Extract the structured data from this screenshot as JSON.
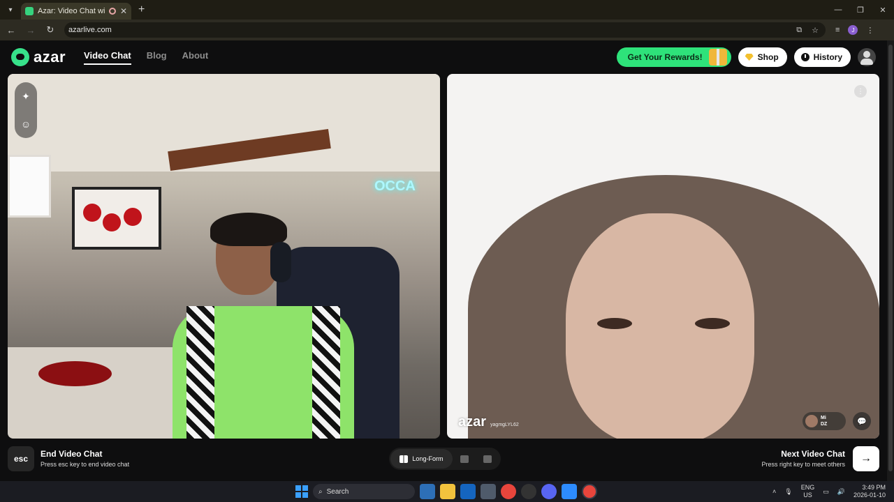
{
  "browser": {
    "tab_title": "Azar: Video Chat with New",
    "tab_close": "✕",
    "new_tab": "+",
    "url": "azarlive.com",
    "profile_initial": "J",
    "window_controls": [
      "—",
      "❐",
      "✕"
    ]
  },
  "header": {
    "logo_text": "azar",
    "nav": [
      "Video Chat",
      "Blog",
      "About"
    ],
    "active_nav": "Video Chat",
    "rewards_label": "Get Your Rewards!",
    "shop_label": "Shop",
    "history_label": "History"
  },
  "left_video": {
    "neon_sign": "OCCA"
  },
  "right_video": {
    "watermark_logo": "azar",
    "watermark_id": "yagmgLYL62",
    "partner_name": "Mi",
    "partner_country": "DZ"
  },
  "controls": {
    "esc_key": "esc",
    "end_title": "End Video Chat",
    "end_hint": "Press esc key to end video chat",
    "layout_label": "Long-Form",
    "next_title": "Next Video Chat",
    "next_hint": "Press right key to meet others",
    "next_arrow": "→"
  },
  "taskbar": {
    "search_placeholder": "Search",
    "lang_top": "ENG",
    "lang_bottom": "US",
    "time": "3:49 PM",
    "date": "2026-01-10"
  },
  "colors": {
    "accent": "#2ee27a",
    "background": "#0e0e0f"
  }
}
